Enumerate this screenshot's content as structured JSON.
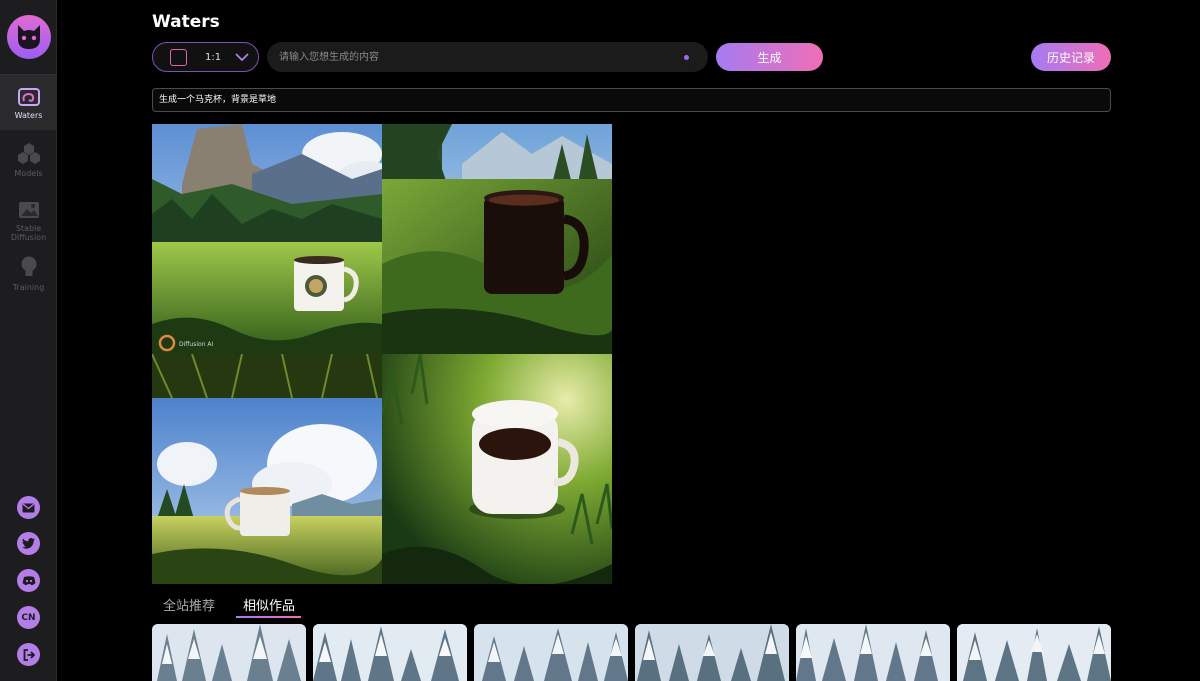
{
  "sidebar": {
    "items": [
      {
        "label": "Waters",
        "icon": "waters-icon"
      },
      {
        "label": "Models",
        "icon": "hexagons-icon"
      },
      {
        "label": "Stable Diffusion",
        "icon": "image-icon"
      },
      {
        "label": "Training",
        "icon": "lightbulb-icon"
      }
    ],
    "social": [
      "mail-icon",
      "twitter-icon",
      "discord-icon",
      "language-icon",
      "logout-icon"
    ],
    "language_label": "CN"
  },
  "header": {
    "title": "Waters",
    "ratio": "1:1",
    "prompt_placeholder": "请输入您想生成的内容",
    "generate_label": "生成",
    "history_label": "历史记录"
  },
  "prompt_display": "生成一个马克杯，背景是草地",
  "result_images": [
    {
      "name": "white-mug-mountain-meadow",
      "watermark": "Diffusion AI"
    },
    {
      "name": "black-mug-forest-grass"
    },
    {
      "name": "white-mug-cloudy-sky"
    },
    {
      "name": "white-mug-closeup-grass"
    }
  ],
  "tabs": [
    {
      "label": "全站推荐",
      "active": false
    },
    {
      "label": "相似作品",
      "active": true
    }
  ],
  "thumbnails": [
    "snow-forest-1",
    "snow-forest-2",
    "snow-forest-3",
    "snow-forest-4",
    "snow-forest-5",
    "snow-forest-6"
  ],
  "colors": {
    "accent_start": "#a57bf3",
    "accent_end": "#f06eb5",
    "background": "#000000",
    "sidebar": "#1d1d1f"
  }
}
